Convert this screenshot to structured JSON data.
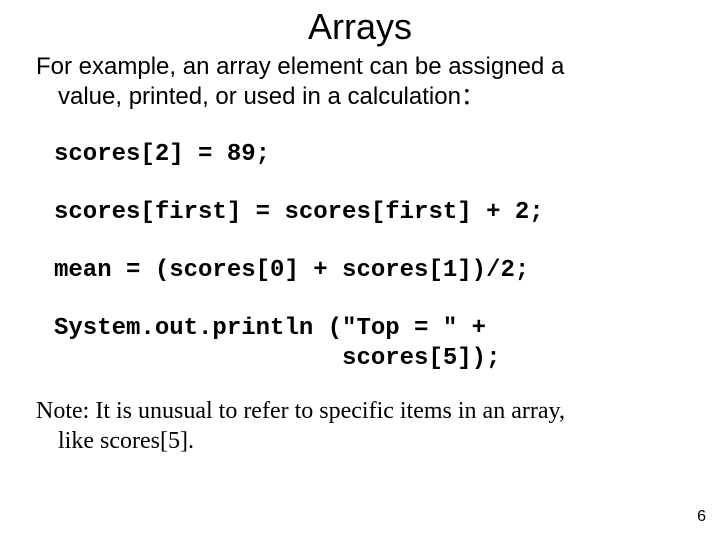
{
  "title": "Arrays",
  "intro_line1": "For example, an array element can be assigned a",
  "intro_line2": "value, printed, or used in a calculation：",
  "code1": "scores[2] = 89;",
  "code2": "scores[first] = scores[first] + 2;",
  "code3": "mean = (scores[0] + scores[1])/2;",
  "code4": "System.out.println (\"Top = \" +\n                    scores[5]);",
  "note_line1": "Note:  It is unusual to refer to specific items in an array,",
  "note_line2": "like scores[5].",
  "page_number": "6"
}
